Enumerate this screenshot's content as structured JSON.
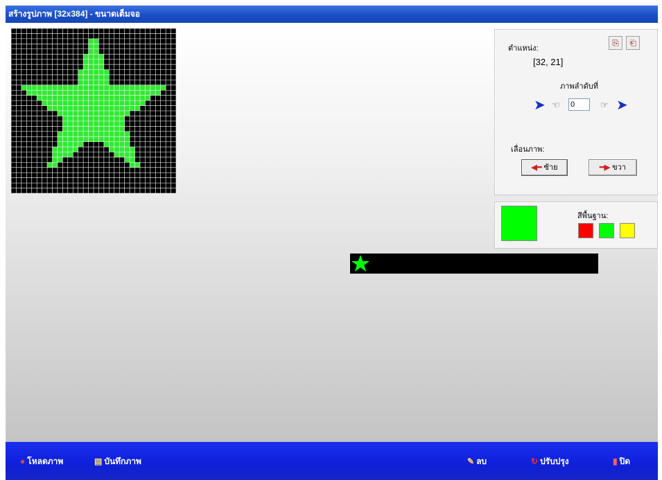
{
  "window": {
    "title": "สร้างรูปภาพ [32x384] - ขนาดเต็มจอ"
  },
  "grid": {
    "columns": 32,
    "rows": 32,
    "background_color": "#000000",
    "cell_color": "#33e833",
    "line_color": "#ffffff"
  },
  "side_panel": {
    "position_label": "ตำแหน่ง:",
    "position_value": "[32, 21]",
    "frame_label": "ภาพลำดับที่",
    "frame_value": "0",
    "shift_label": "เลื่อนภาพ:",
    "left_button": "ซ้าย",
    "right_button": "ขวา",
    "icons": [
      "copy-icon",
      "paste-icon",
      "arrow-left-icon",
      "hand-left-icon",
      "hand-right-icon",
      "arrow-right-icon"
    ]
  },
  "color_panel": {
    "current_color": "#00ff00",
    "base_colors_label": "สีพื้นฐาน:",
    "base_colors": [
      "#ff0000",
      "#00ff00",
      "#ffff00"
    ]
  },
  "preview": {
    "background": "#000000",
    "color": "#00ff00"
  },
  "taskbar": {
    "load": "โหลดภาพ",
    "save": "บันทึกภาพ",
    "clear": "ลบ",
    "refresh": "ปรับปรุง",
    "close": "ปิด"
  }
}
